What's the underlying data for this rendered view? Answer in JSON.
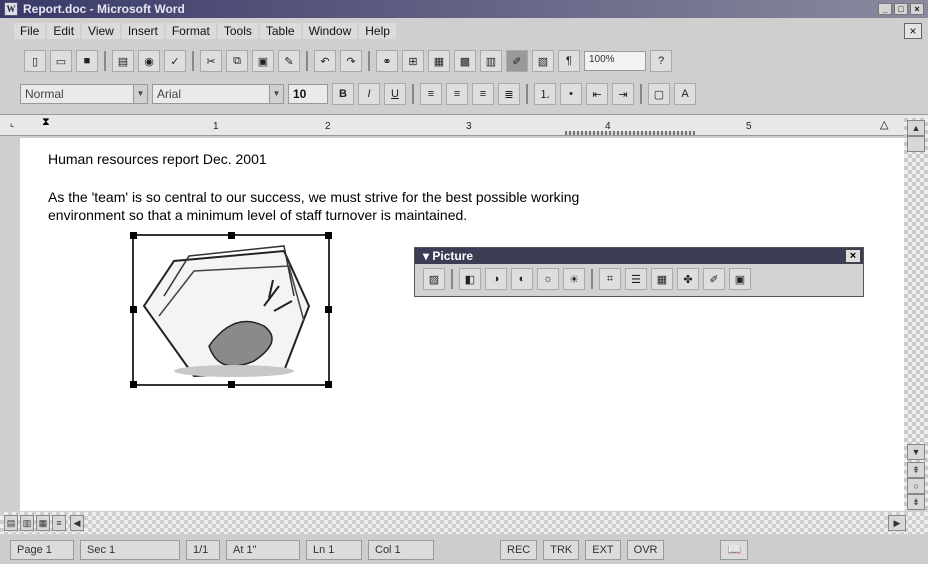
{
  "window": {
    "title": "Report.doc - Microsoft Word"
  },
  "menu": [
    "File",
    "Edit",
    "View",
    "Insert",
    "Format",
    "Tools",
    "Table",
    "Window",
    "Help"
  ],
  "toolbar": {
    "zoom": "100%"
  },
  "format": {
    "style": "Normal",
    "font": "Arial",
    "size": "10"
  },
  "ruler": {
    "marks": [
      "1",
      "2",
      "3",
      "4",
      "5"
    ]
  },
  "document": {
    "heading": "Human resources report Dec. 2001",
    "para1": "As the 'team' is so central to our success, we must strive for the best possible working",
    "para2": "environment so that a minimum level of staff turnover is maintained."
  },
  "picture_toolbar": {
    "title": "Picture"
  },
  "status": {
    "page": "Page 1",
    "sec": "Sec 1",
    "pages": "1/1",
    "at": "At 1\"",
    "ln": "Ln 1",
    "col": "Col 1",
    "rec": "REC",
    "trk": "TRK",
    "ext": "EXT",
    "ovr": "OVR"
  }
}
